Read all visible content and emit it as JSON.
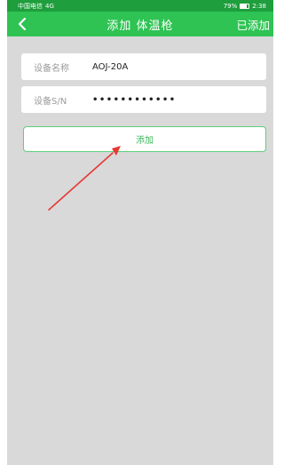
{
  "status_bar": {
    "carrier": "中国电信",
    "signal": "4G",
    "battery": "79%",
    "time": "2:38"
  },
  "nav": {
    "title": "添加 体温枪",
    "action_label": "已添加"
  },
  "form": {
    "name_label": "设备名称",
    "name_value": "AOJ-20A",
    "sn_label": "设备S/N",
    "sn_value": "••••••••••••"
  },
  "add_button_label": "添加",
  "colors": {
    "nav": "#2ec353",
    "status": "#1e9e3c",
    "button_border": "#5fcf7a",
    "annotation_arrow": "#e53935"
  },
  "icons": {
    "back": "chevron-left-icon",
    "arrow": "annotation-arrow-icon"
  }
}
